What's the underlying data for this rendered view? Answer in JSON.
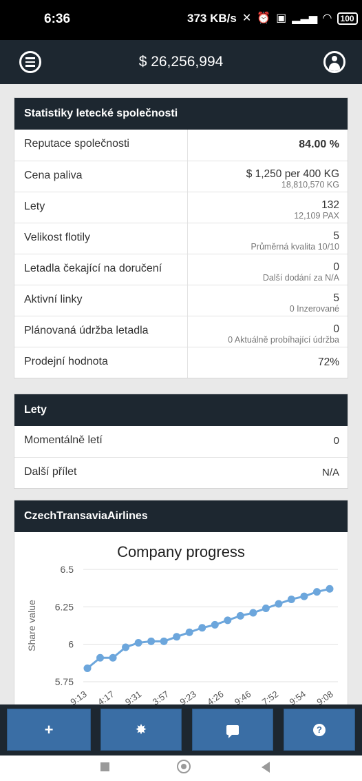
{
  "status_bar": {
    "time": "6:36",
    "network_speed": "373 KB/s",
    "battery": "100"
  },
  "header": {
    "balance": "$ 26,256,994",
    "menu_icon": "menu-icon",
    "profile_icon": "profile-icon"
  },
  "stats": {
    "title": "Statistiky letecké společnosti",
    "rows": [
      {
        "label": "Reputace společnosti",
        "value": "84.00 %",
        "sub": ""
      },
      {
        "label": "Cena paliva",
        "value": "$ 1,250 per 400 KG",
        "sub": "18,810,570 KG"
      },
      {
        "label": "Lety",
        "value": "132",
        "sub": "12,109 PAX"
      },
      {
        "label": "Velikost flotily",
        "value": "5",
        "sub": "Průměrná kvalita 10/10"
      },
      {
        "label": "Letadla čekající na doručení",
        "value": "0",
        "sub": "Další dodání za N/A"
      },
      {
        "label": "Aktivní linky",
        "value": "5",
        "sub": "0 Inzerované"
      },
      {
        "label": "Plánovaná údržba letadla",
        "value": "0",
        "sub": "0 Aktuálně probíhající údržba"
      },
      {
        "label": "Prodejní hodnota",
        "value": "72%",
        "sub": ""
      }
    ]
  },
  "flights": {
    "title": "Lety",
    "rows": [
      {
        "label": "Momentálně letí",
        "value": "0"
      },
      {
        "label": "Další přílet",
        "value": "N/A"
      }
    ]
  },
  "company": {
    "title": "CzechTransaviaAirlines"
  },
  "chart_data": {
    "type": "line",
    "title": "Company progress",
    "ylabel": "Share value",
    "xlabel": "",
    "ylim": [
      5.75,
      6.5
    ],
    "yticks": [
      "6.5",
      "6.25",
      "6",
      "5.75"
    ],
    "xtick_labels": [
      "9:13",
      "4:17",
      "9:31",
      "3:57",
      "9:23",
      "4:26",
      "9:46",
      "7:52",
      "9:54",
      "9:08"
    ],
    "values": [
      5.84,
      5.91,
      5.91,
      5.98,
      6.01,
      6.02,
      6.02,
      6.05,
      6.08,
      6.11,
      6.13,
      6.16,
      6.19,
      6.21,
      6.24,
      6.27,
      6.3,
      6.32,
      6.35,
      6.37
    ],
    "series_color": "#6ca6dc",
    "grid": true
  },
  "toolbar": {
    "buttons": [
      {
        "name": "add",
        "label": "+"
      },
      {
        "name": "settings",
        "label": "✸"
      },
      {
        "name": "messages",
        "label": ""
      },
      {
        "name": "help",
        "label": "?"
      }
    ]
  },
  "colors": {
    "header_bg": "#1d2730",
    "button_bg": "#3a6ea5",
    "page_bg": "#e9e9e9"
  }
}
